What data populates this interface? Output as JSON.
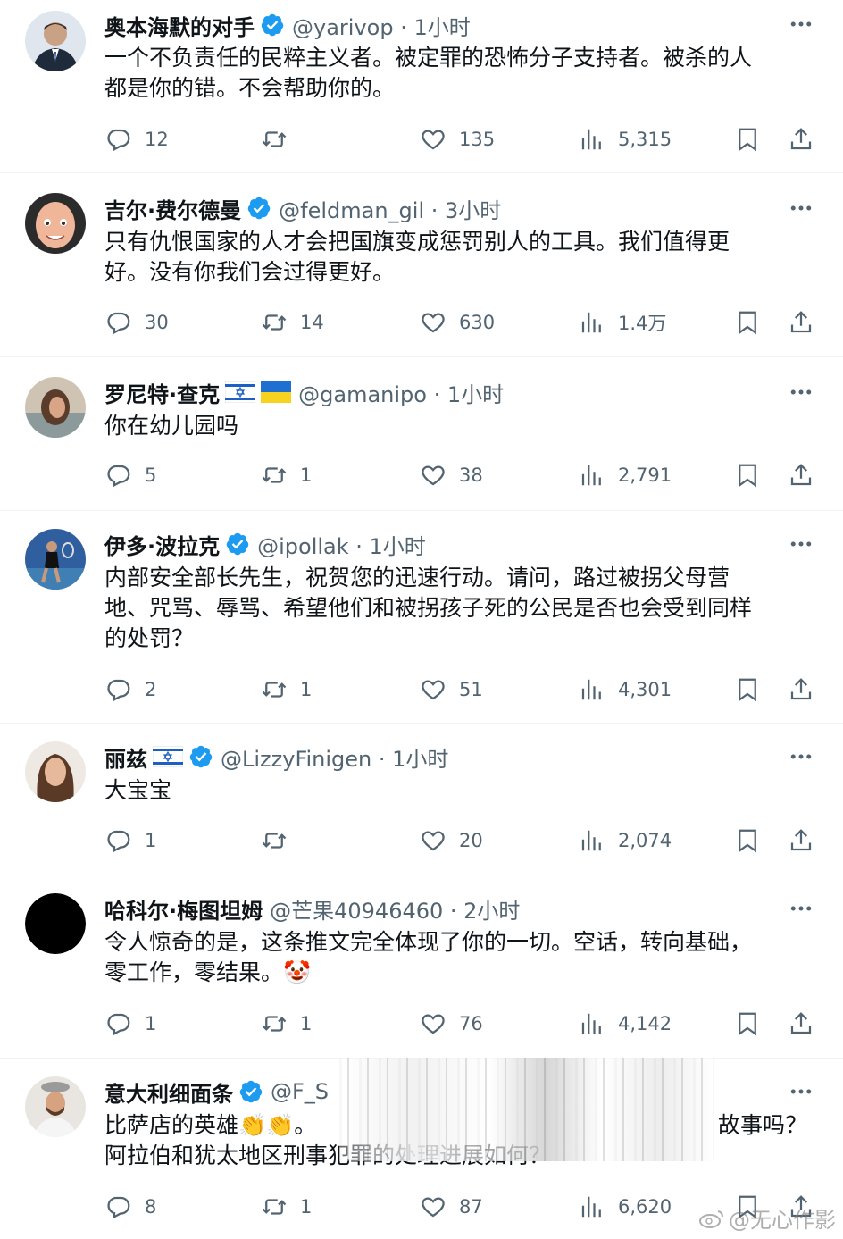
{
  "colors": {
    "accent": "#1d9bf0",
    "text": "#0f1419",
    "muted": "#536471",
    "separator": "#eff3f4"
  },
  "tweets": [
    {
      "name": "奥本海默的对手",
      "verified": true,
      "flags": [],
      "handle": "@yarivop · 1小时",
      "text": [
        "一个不负责任的民粹主义者。被定罪的恐怖分子支持者。被杀的人",
        "都是你的错。不会帮助你的。"
      ],
      "replies": "12",
      "retweets": "",
      "likes": "135",
      "views": "5,315",
      "avatar_icon": "man-suit-avatar"
    },
    {
      "name": "吉尔·费尔德曼",
      "verified": true,
      "flags": [],
      "handle": "@feldman_gil · 3小时",
      "text": [
        "只有仇恨国家的人才会把国旗变成惩罚别人的工具。我们值得更",
        "好。没有你我们会过得更好。"
      ],
      "replies": "30",
      "retweets": "14",
      "likes": "630",
      "views": "1.4万",
      "avatar_icon": "cartoon-bald-avatar"
    },
    {
      "name": "罗尼特·查克",
      "verified": false,
      "flags": [
        "israel",
        "ukraine"
      ],
      "handle": "@gamanipo · 1小时",
      "text": [
        "你在幼儿园吗"
      ],
      "replies": "5",
      "retweets": "1",
      "likes": "38",
      "views": "2,791",
      "avatar_icon": "woman-photo-avatar"
    },
    {
      "name": "伊多·波拉克",
      "verified": true,
      "flags": [],
      "handle": "@ipollak · 1小时",
      "text": [
        "内部安全部长先生，祝贺您的迅速行动。请问，路过被拐父母营",
        "地、咒骂、辱骂、希望他们和被拐孩子死的公民是否也会受到同样",
        "的处罚？"
      ],
      "replies": "2",
      "retweets": "1",
      "likes": "51",
      "views": "4,301",
      "avatar_icon": "tennis-player-avatar"
    },
    {
      "name": "丽兹",
      "verified": true,
      "flags": [
        "israel"
      ],
      "handle": "@LizzyFinigen · 1小时",
      "text": [
        "大宝宝"
      ],
      "replies": "1",
      "retweets": "",
      "likes": "20",
      "views": "2,074",
      "avatar_icon": "woman-portrait-avatar"
    },
    {
      "name": "哈科尔·梅图坦姆",
      "verified": false,
      "flags": [],
      "handle": "@芒果40946460 · 2小时",
      "text": [
        "令人惊奇的是，这条推文完全体现了你的一切。空话，转向基础，",
        "零工作，零结果。🤡"
      ],
      "replies": "1",
      "retweets": "1",
      "likes": "76",
      "views": "4,142",
      "avatar_icon": "black-circle-avatar"
    },
    {
      "name": "意大利细面条",
      "verified": true,
      "flags": [],
      "handle": "@F_S",
      "text": [
        "比萨店的英雄👏👏。",
        "阿拉伯和犹太地区刑事犯罪的处理进展如何？"
      ],
      "text_right": "故事吗？",
      "replies": "8",
      "retweets": "1",
      "likes": "87",
      "views": "6,620",
      "avatar_icon": "chef-man-avatar"
    }
  ],
  "watermark": "@无心作影"
}
